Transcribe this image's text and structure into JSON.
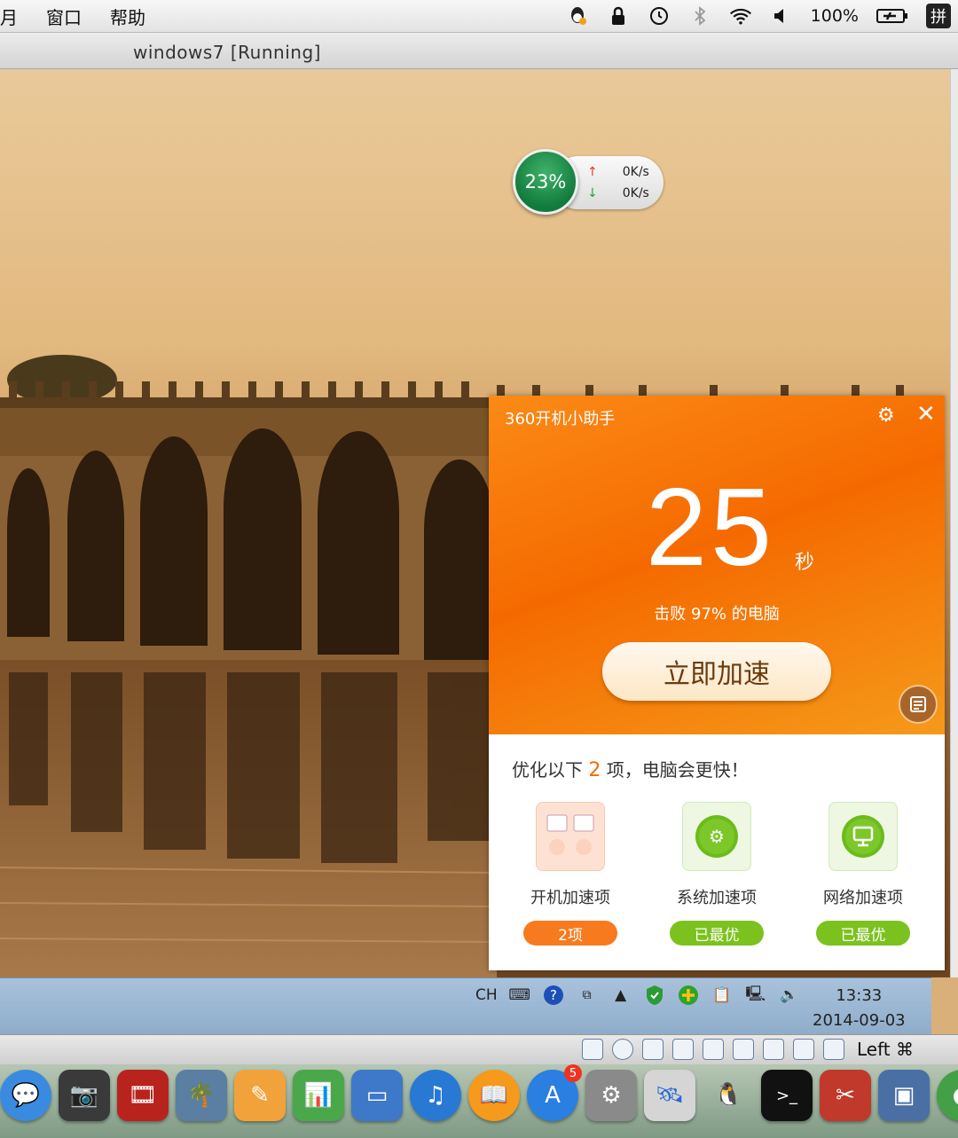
{
  "menubar": {
    "items": [
      "月",
      "窗口",
      "帮助"
    ],
    "battery": "100%",
    "ime": "拼"
  },
  "vm": {
    "title": "windows7 [Running]",
    "host_key": "Left ⌘"
  },
  "net_widget": {
    "percent": "23%",
    "up": "0K/s",
    "down": "0K/s"
  },
  "assistant": {
    "title": "360开机小助手",
    "seconds": "25",
    "unit": "秒",
    "beat_text": "击败 97% 的电脑",
    "button": "立即加速",
    "tip_prefix": "优化以下",
    "tip_count": "2",
    "tip_suffix": "项，电脑会更快！",
    "items": [
      {
        "label": "开机加速项",
        "status": "2项",
        "color": "#f77a1e"
      },
      {
        "label": "系统加速项",
        "status": "已最优",
        "color": "#7cc21e"
      },
      {
        "label": "网络加速项",
        "status": "已最优",
        "color": "#7cc21e"
      }
    ]
  },
  "win7_tray": {
    "lang": "CH",
    "time": "13:33",
    "date": "2014-09-03"
  },
  "dock": {
    "badge": "5"
  }
}
